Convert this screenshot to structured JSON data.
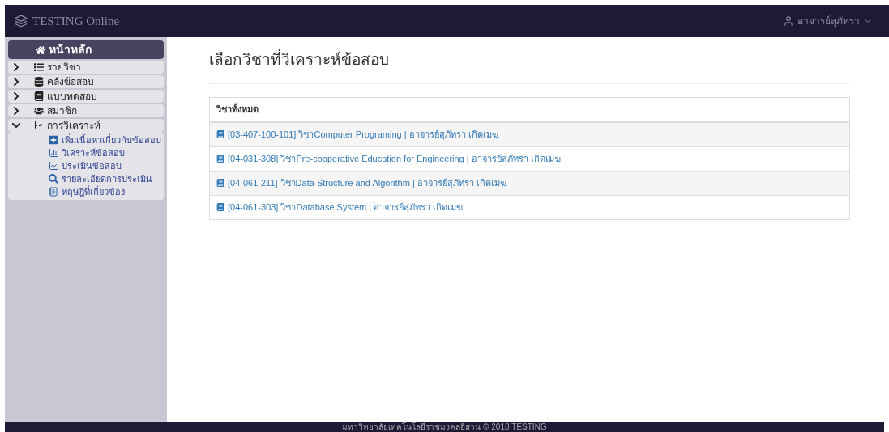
{
  "navbar": {
    "brand": "TESTING Online",
    "user": "อาจารย์สุภัทรา"
  },
  "sidebar": {
    "items": [
      {
        "label": "หน้าหลัก",
        "selected": true
      },
      {
        "label": "รายวิชา",
        "selected": false,
        "expanded": false
      },
      {
        "label": "คลังข้อสอบ",
        "selected": false,
        "expanded": false
      },
      {
        "label": "แบบทดสอบ",
        "selected": false,
        "expanded": false
      },
      {
        "label": "สมาชิก",
        "selected": false,
        "expanded": false
      },
      {
        "label": "การวิเคราะห์",
        "selected": false,
        "expanded": true,
        "children": [
          {
            "label": "เพิ่มเนื้อหาเกี่ยวกับข้อสอบ"
          },
          {
            "label": "วิเคราะห์ข้อสอบ"
          },
          {
            "label": "ประเมินข้อสอบ"
          },
          {
            "label": "รายละเอียดการประเมิน"
          },
          {
            "label": "ทฤษฎีที่เกี่ยวข้อง"
          }
        ]
      }
    ]
  },
  "page_title": "เลือกวิชาที่วิเคราะห์ข้อสอบ",
  "panel": {
    "heading": "วิชาทั้งหมด",
    "rows": [
      "[03-407-100-101] วิชาComputer Programing | อาจารย์สุภัทรา เกิดเมฆ",
      "[04-031-308] วิชาPre-cooperative Education for Engineering | อาจารย์สุภัทรา เกิดเมฆ",
      "[04-061-211] วิชาData Structure and Algorithm | อาจารย์สุภัทรา เกิดเมฆ",
      "[04-061-303] วิชาDatabase System | อาจารย์สุภัทรา เกิดเมฆ"
    ]
  },
  "footer": "มหาวิทยาลัยเทคโนโลยีราชมงคลอีสาน © 2018 TESTING"
}
